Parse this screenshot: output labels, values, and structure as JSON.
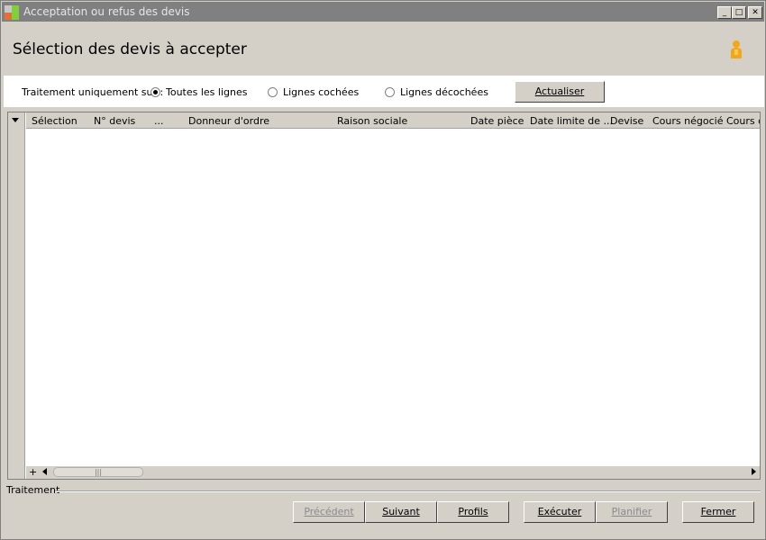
{
  "window": {
    "title": "Acceptation ou refus des devis"
  },
  "header": {
    "page_title": "Sélection des devis à accepter"
  },
  "filter": {
    "label": "Traitement uniquement sur :",
    "options": [
      {
        "label": "Toutes les lignes",
        "selected": true
      },
      {
        "label": "Lignes cochées",
        "selected": false
      },
      {
        "label": "Lignes décochées",
        "selected": false
      }
    ],
    "refresh_button": "Actualiser"
  },
  "grid": {
    "columns": [
      "Sélection",
      "N° devis",
      "...",
      "Donneur d'ordre",
      "Raison sociale",
      "Date pièce",
      "Date limite de ...",
      "Devise",
      "Cours négocié",
      "Cours d"
    ],
    "rows": []
  },
  "footer": {
    "group_label": "Traitement",
    "buttons": {
      "previous": "Précédent",
      "next": "Suivant",
      "profiles": "Profils",
      "execute": "Exécuter",
      "schedule": "Planifier",
      "close": "Fermer"
    }
  },
  "colors": {
    "titlebar": "#808080",
    "window_bg": "#d4d0c8",
    "user_icon": "#f0a818"
  }
}
